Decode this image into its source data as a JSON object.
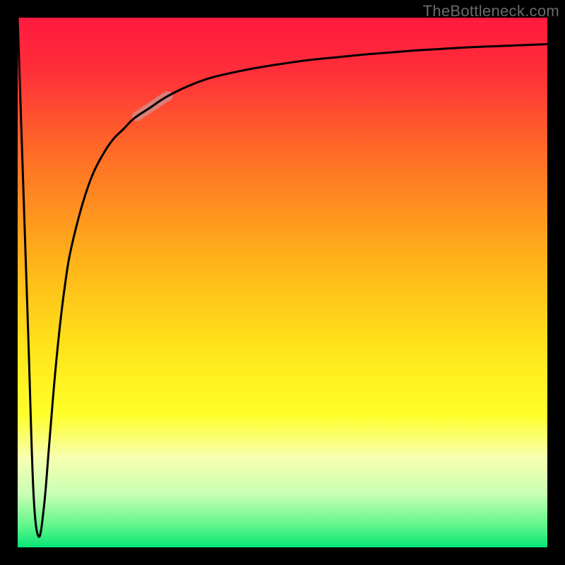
{
  "watermark": "TheBottleneck.com",
  "gradient": {
    "stops": [
      {
        "offset": 0.0,
        "color": "#ff1a3e"
      },
      {
        "offset": 0.1,
        "color": "#ff2e3a"
      },
      {
        "offset": 0.25,
        "color": "#ff6a27"
      },
      {
        "offset": 0.45,
        "color": "#ffb01a"
      },
      {
        "offset": 0.62,
        "color": "#ffe31a"
      },
      {
        "offset": 0.75,
        "color": "#ffff2a"
      },
      {
        "offset": 0.83,
        "color": "#f7ffb0"
      },
      {
        "offset": 0.9,
        "color": "#c8ffb4"
      },
      {
        "offset": 0.96,
        "color": "#5ef58a"
      },
      {
        "offset": 1.0,
        "color": "#06e676"
      }
    ]
  },
  "highlight_segment": {
    "color": "#cf9090",
    "opacity": 0.75,
    "width": 14,
    "x1_frac": 0.225,
    "x2_frac": 0.285
  },
  "chart_data": {
    "type": "line",
    "title": "",
    "xlabel": "",
    "ylabel": "",
    "xlim": [
      0,
      100
    ],
    "ylim": [
      0,
      100
    ],
    "x": [
      0,
      1,
      2,
      3,
      4,
      5,
      6,
      7,
      8,
      9,
      10,
      12,
      14,
      16,
      18,
      20,
      22,
      25,
      28,
      32,
      36,
      40,
      45,
      50,
      55,
      60,
      65,
      70,
      75,
      80,
      85,
      90,
      95,
      100
    ],
    "values": [
      100,
      70,
      40,
      10,
      2,
      8,
      20,
      32,
      42,
      50,
      56,
      64,
      70,
      74,
      77,
      79,
      81,
      83,
      85,
      87,
      88.5,
      89.5,
      90.5,
      91.3,
      92,
      92.5,
      93,
      93.4,
      93.8,
      94.1,
      94.4,
      94.6,
      94.8,
      95
    ],
    "curve_color": "#000000",
    "curve_width": 3
  }
}
